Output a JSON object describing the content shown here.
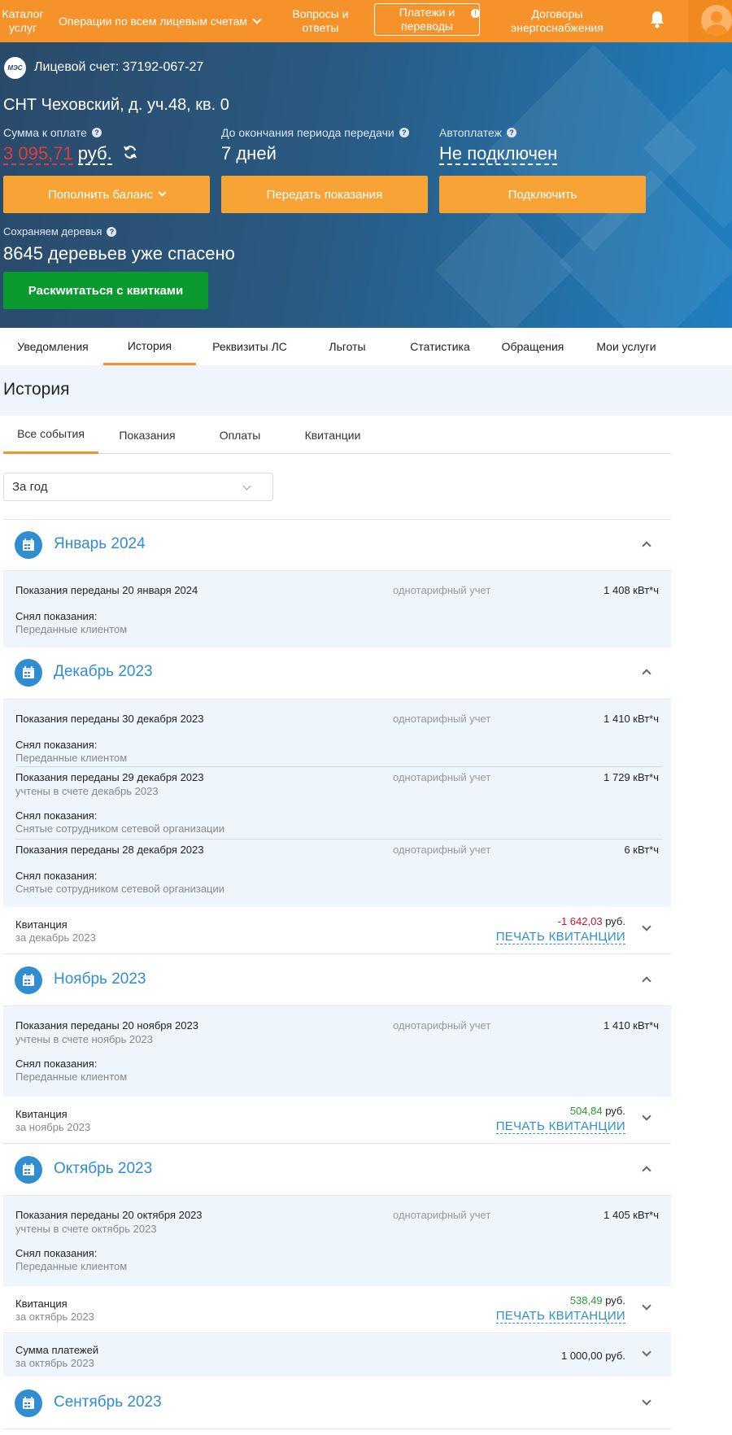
{
  "topnav": {
    "catalog": "Каталог услуг",
    "operations": "Операции по всем лицевым счетам",
    "faq": "Вопросы и ответы",
    "payments": "Платежи и переводы",
    "payments_badge": "!",
    "contracts": "Договоры энергоснабжения",
    "bell_icon": "bell-icon",
    "avatar_icon": "user-avatar-icon"
  },
  "hero": {
    "logo": "МЭС",
    "account_label": "Лицевой счет:",
    "account_number": "37192-067-27",
    "address": "СНТ Чеховский, д. уч.48, кв. 0",
    "sum_label": "Сумма к оплате",
    "sum_value": "3 095,71",
    "sum_currency": "руб.",
    "period_label": "До окончания периода передачи",
    "period_value": "7 дней",
    "autopay_label": "Автоплатеж",
    "autopay_value": "Не подключен",
    "btn_topup": "Пополнить баланс",
    "btn_readings": "Передать показания",
    "btn_connect": "Подключить",
    "trees_label": "Сохраняем деревья",
    "trees_value": "8645 деревьев уже спасено",
    "btn_paperless": "Раскwитаться с квитками"
  },
  "main_tabs": [
    "Уведомления",
    "История",
    "Реквизиты ЛС",
    "Льготы",
    "Статистика",
    "Обращения",
    "Мои услуги"
  ],
  "history": {
    "title": "История",
    "sub_tabs": [
      "Все события",
      "Показания",
      "Оплаты",
      "Квитанции"
    ],
    "period": "За год",
    "months": [
      {
        "title": "Январь 2024",
        "readings": [
          {
            "title": "Показания переданы 20 января 2024",
            "sub": "",
            "tariff": "однотарифный учет",
            "value": "1 408 кВт*ч",
            "who_label": "Снял показания:",
            "who": "Переданные клиентом"
          }
        ]
      },
      {
        "title": "Декабрь 2023",
        "readings": [
          {
            "title": "Показания переданы 30 декабря 2023",
            "sub": "",
            "tariff": "однотарифный учет",
            "value": "1 410 кВт*ч",
            "who_label": "Снял показания:",
            "who": "Переданные клиентом"
          },
          {
            "title": "Показания переданы 29 декабря 2023",
            "sub": "учтены в счете декабрь 2023",
            "tariff": "однотарифный учет",
            "value": "1 729 кВт*ч",
            "who_label": "Снял показания:",
            "who": "Снятые сотрудником сетевой организации"
          },
          {
            "title": "Показания переданы 28 декабря 2023",
            "sub": "",
            "tariff": "однотарифный учет",
            "value": "6 кВт*ч",
            "who_label": "Снял показания:",
            "who": "Снятые сотрудником сетевой организации"
          }
        ],
        "receipt": {
          "title": "Квитанция",
          "sub": "за декабрь 2023",
          "amount": "-1 642,03",
          "unit": "руб.",
          "print": "ПЕЧАТЬ КВИТАНЦИИ"
        }
      },
      {
        "title": "Ноябрь 2023",
        "readings": [
          {
            "title": "Показания переданы 20 ноября 2023",
            "sub": "учтены в счете ноябрь 2023",
            "tariff": "однотарифный учет",
            "value": "1 410 кВт*ч",
            "who_label": "Снял показания:",
            "who": "Переданные клиентом"
          }
        ],
        "receipt": {
          "title": "Квитанция",
          "sub": "за ноябрь 2023",
          "amount": "504,84",
          "unit": "руб.",
          "print": "ПЕЧАТЬ КВИТАНЦИИ"
        }
      },
      {
        "title": "Октябрь 2023",
        "readings": [
          {
            "title": "Показания переданы 20 октября 2023",
            "sub": "учтены в счете октябрь 2023",
            "tariff": "однотарифный учет",
            "value": "1 405 кВт*ч",
            "who_label": "Снял показания:",
            "who": "Переданные клиентом"
          }
        ],
        "receipt": {
          "title": "Квитанция",
          "sub": "за октябрь 2023",
          "amount": "538,49",
          "unit": "руб.",
          "print": "ПЕЧАТЬ КВИТАНЦИИ"
        },
        "payments": {
          "title": "Сумма платежей",
          "sub": "за октябрь 2023",
          "amount": "1 000,00 руб."
        }
      },
      {
        "title": "Сентябрь 2023"
      }
    ]
  },
  "colors": {
    "nav": "#f5922a",
    "accent_blue": "#2f8dd0",
    "negative": "#c8102e",
    "positive": "#2a9a2a",
    "green_button": "#0b9a2f"
  }
}
